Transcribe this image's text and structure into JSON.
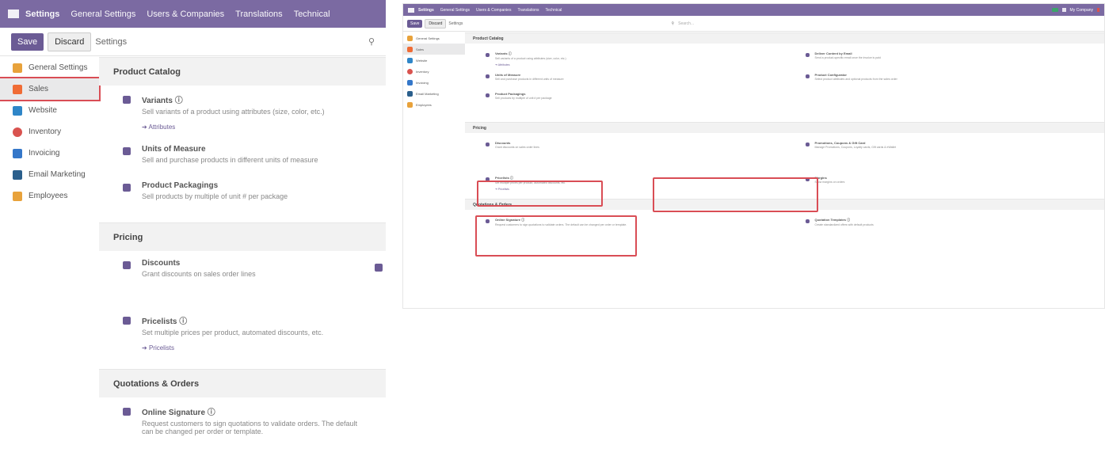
{
  "left": {
    "topbar": {
      "app": "Settings",
      "menus": [
        "General Settings",
        "Users & Companies",
        "Translations",
        "Technical"
      ]
    },
    "control_panel": {
      "save": "Save",
      "discard": "Discard",
      "title": "Settings"
    },
    "sidebar": {
      "items": [
        {
          "label": "General Settings",
          "color": "#e8a23b"
        },
        {
          "label": "Sales",
          "color": "#f06c35"
        },
        {
          "label": "Website",
          "color": "#2f86c8"
        },
        {
          "label": "Inventory",
          "color": "#d9534f"
        },
        {
          "label": "Invoicing",
          "color": "#3477c9"
        },
        {
          "label": "Email Marketing",
          "color": "#2b5f8c"
        },
        {
          "label": "Employees",
          "color": "#e8a23b"
        }
      ]
    },
    "sections": [
      {
        "title": "Product Catalog",
        "items": [
          {
            "title": "Variants",
            "desc": "Sell variants of a product using attributes (size, color, etc.)",
            "link": "Attributes"
          },
          {
            "title": "Units of Measure",
            "desc": "Sell and purchase products in different units of measure"
          },
          {
            "title": "Product Packagings",
            "desc": "Sell products by multiple of unit # per package"
          }
        ]
      },
      {
        "title": "Pricing",
        "items": [
          {
            "title": "Discounts",
            "desc": "Grant discounts on sales order lines"
          },
          {
            "title": "Pricelists",
            "desc": "Set multiple prices per product, automated discounts, etc.",
            "link": "Pricelists"
          }
        ]
      },
      {
        "title": "Quotations & Orders",
        "items": [
          {
            "title": "Online Signature",
            "desc": "Request customers to sign quotations to validate orders. The default can be changed per order or template."
          }
        ]
      }
    ]
  },
  "right": {
    "topbar": {
      "app": "Settings",
      "menus": [
        "General Settings",
        "Users & Companies",
        "Translations",
        "Technical"
      ],
      "user": "My Company"
    },
    "control_panel": {
      "save": "Save",
      "discard": "Discard",
      "title": "Settings",
      "search_placeholder": "Search..."
    },
    "sidebar": {
      "items": [
        {
          "label": "General Settings",
          "color": "#e8a23b"
        },
        {
          "label": "Sales",
          "color": "#f06c35"
        },
        {
          "label": "Website",
          "color": "#2f86c8"
        },
        {
          "label": "Inventory",
          "color": "#d9534f"
        },
        {
          "label": "Invoicing",
          "color": "#3477c9"
        },
        {
          "label": "Email Marketing",
          "color": "#2b5f8c"
        },
        {
          "label": "Employees",
          "color": "#e8a23b"
        }
      ]
    },
    "sections": [
      {
        "title": "Product Catalog",
        "items": [
          {
            "title": "Variants",
            "desc": "Sell variants of a product using attributes (size, color, etc.)",
            "link": "Attributes",
            "checked": true
          },
          {
            "title": "Deliver Content by Email",
            "desc": "Send a product-specific email once the invoice is paid"
          },
          {
            "title": "Units of Measure",
            "desc": "Sell and purchase products in different units of measure"
          },
          {
            "title": "Product Configurator",
            "desc": "Select product attributes and optional products from the sales order"
          },
          {
            "title": "Product Packagings",
            "desc": "Sell products by multiple of unit # per package"
          }
        ]
      },
      {
        "title": "Pricing",
        "items": [
          {
            "title": "Discounts",
            "desc": "Grant discounts on sales order lines",
            "checked": true
          },
          {
            "title": "Promotions, Coupons & Gift Card",
            "desc": "Manage Promotions, Coupons, Loyalty cards, Gift cards & eWallet",
            "checked": true
          },
          {
            "title": "Pricelists",
            "desc": "Set multiple prices per product, automated discounts, etc.",
            "link": "Pricelists",
            "checked": true
          },
          {
            "title": "Margins",
            "desc": "Show margins on orders"
          }
        ]
      },
      {
        "title": "Quotations & Orders",
        "items": [
          {
            "title": "Online Signature",
            "desc": "Request customers to sign quotations to validate orders. The default can be changed per order or template.",
            "checked": true
          },
          {
            "title": "Quotation Templates",
            "desc": "Create standardized offers with default products"
          }
        ]
      }
    ]
  }
}
